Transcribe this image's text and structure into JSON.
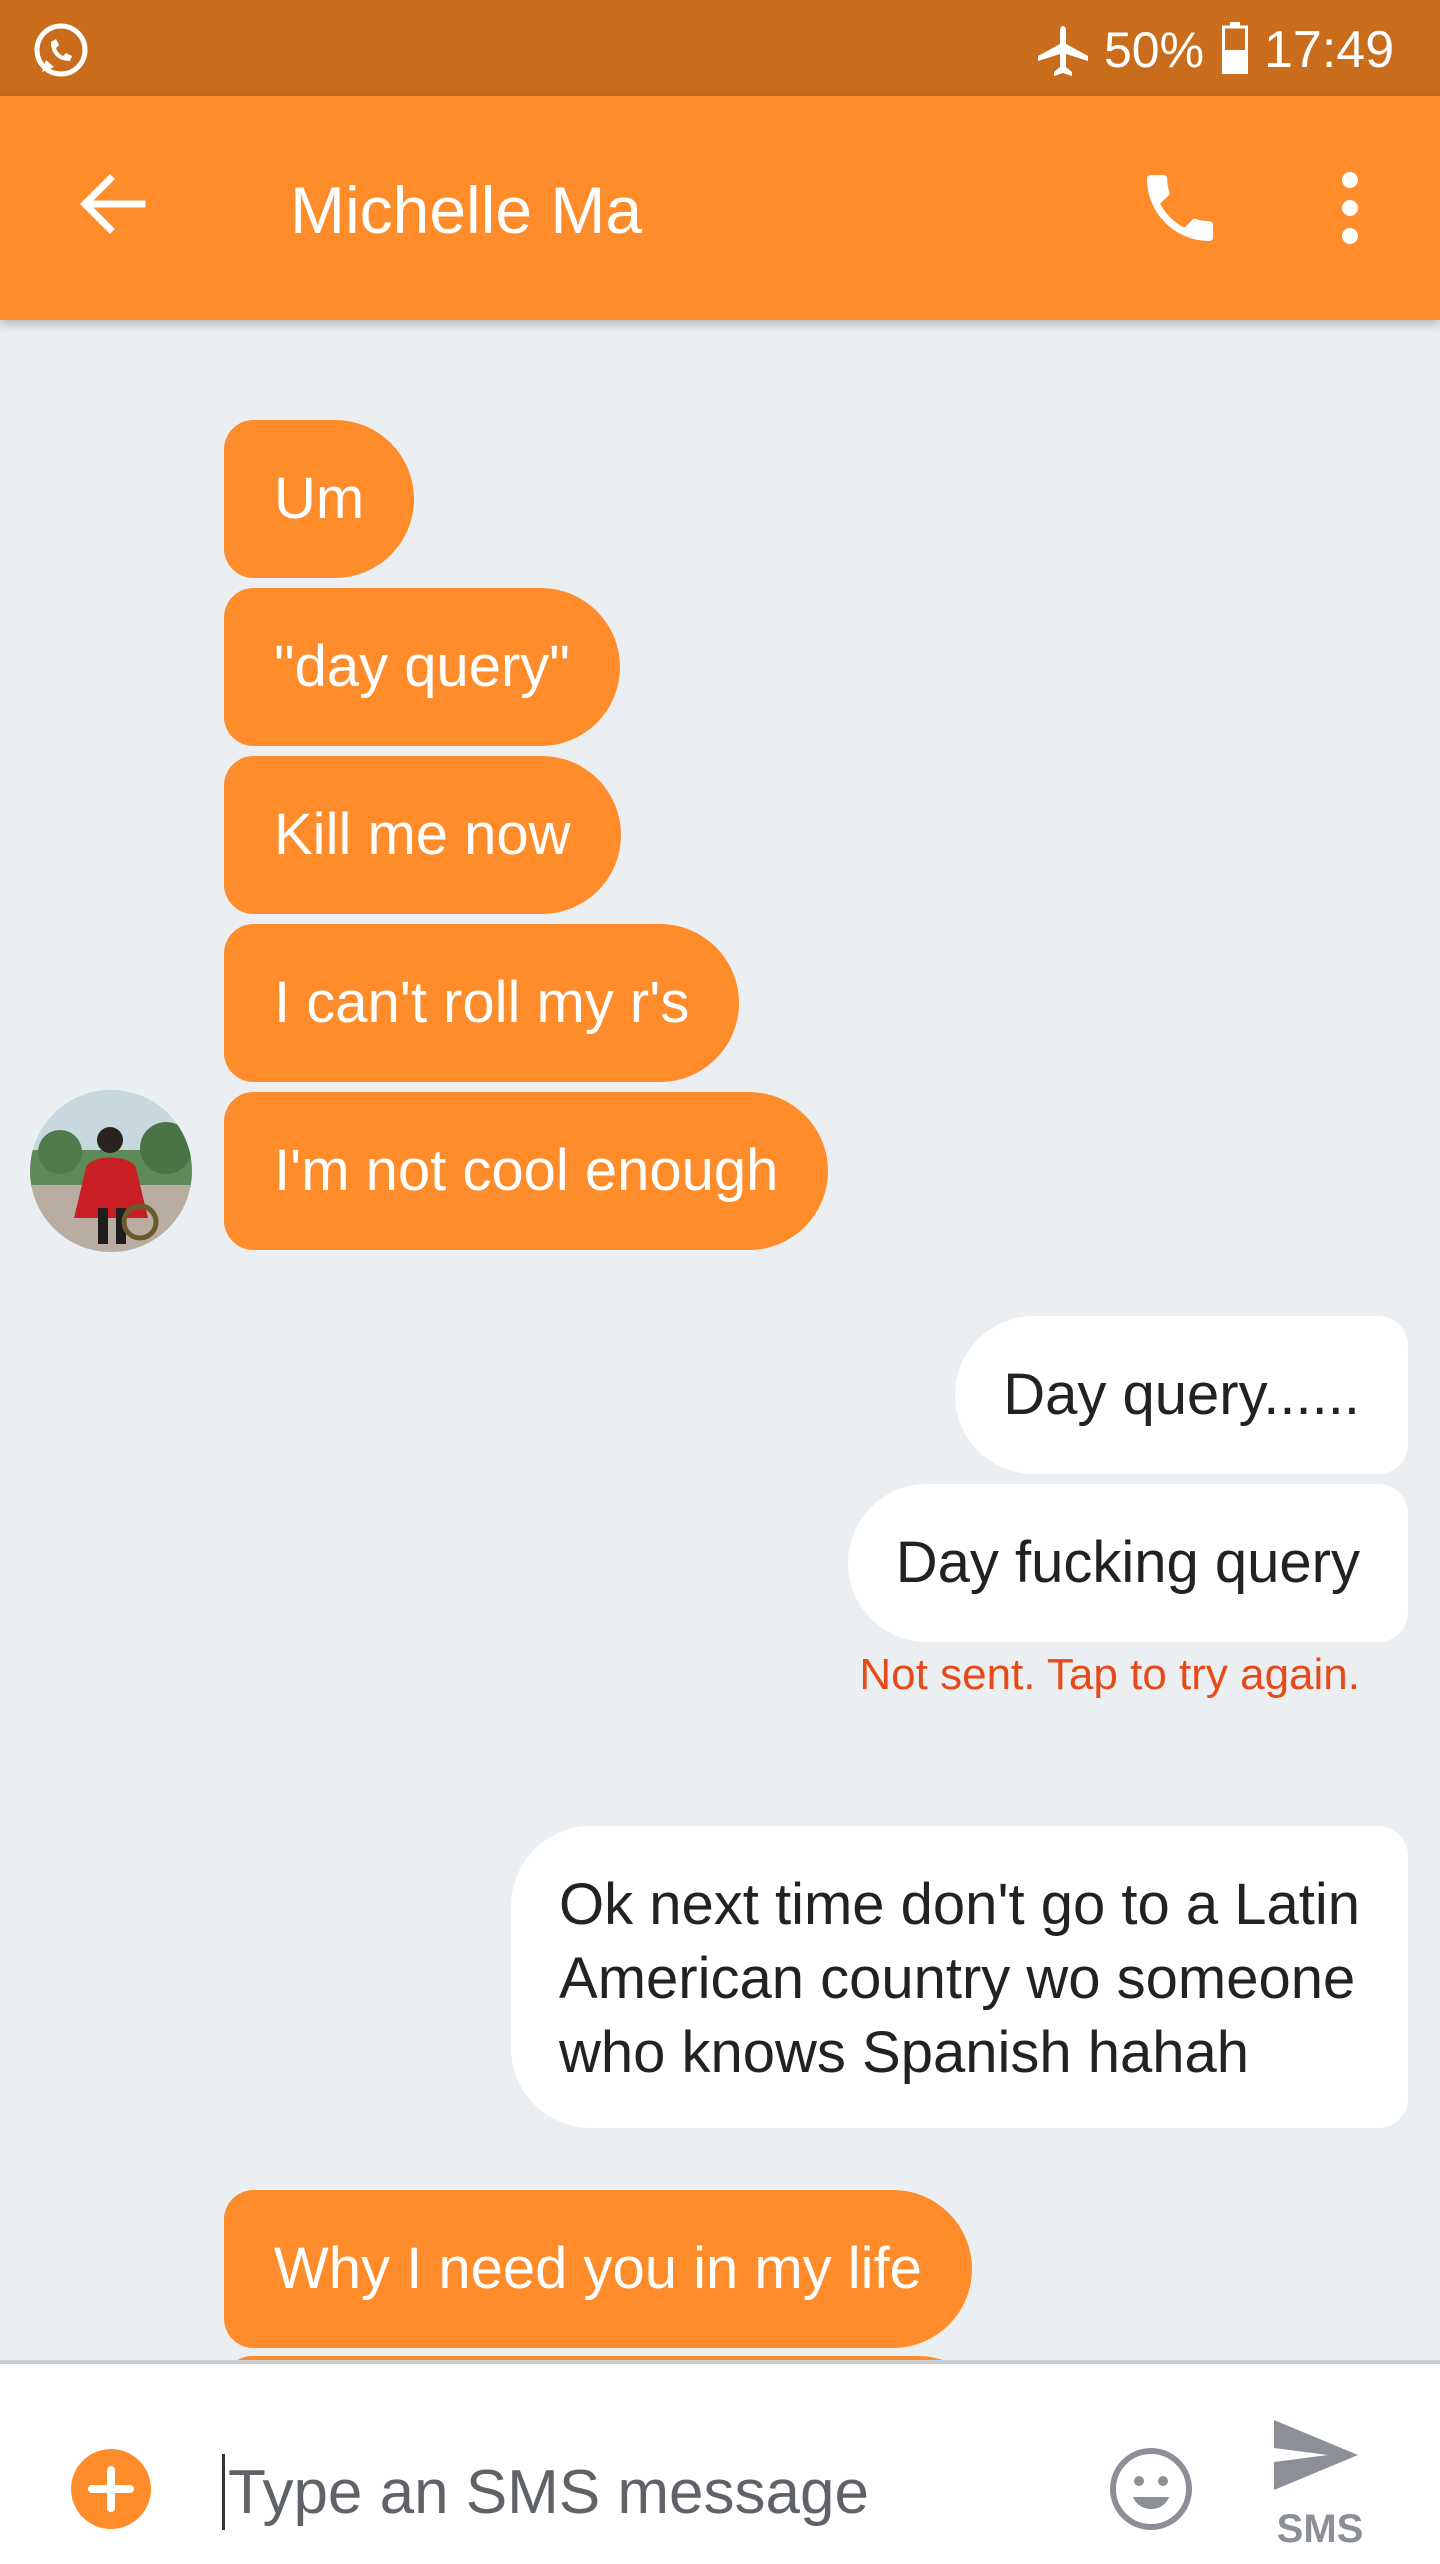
{
  "status_bar": {
    "app_icon": "whatsapp-icon",
    "airplane_icon": "airplane-icon",
    "battery_percent": "50%",
    "battery_level": 0.5,
    "time": "17:49"
  },
  "header": {
    "back_icon": "arrow-left-icon",
    "title": "Michelle Ma",
    "call_icon": "phone-icon",
    "menu_icon": "more-vert-icon"
  },
  "messages": [
    {
      "direction": "incoming",
      "text": "Um"
    },
    {
      "direction": "incoming",
      "text": "\"day query\""
    },
    {
      "direction": "incoming",
      "text": "Kill me now"
    },
    {
      "direction": "incoming",
      "text": "I can't roll my r's"
    },
    {
      "direction": "incoming",
      "text": "I'm not cool enough"
    },
    {
      "direction": "outgoing",
      "text": "Day query......"
    },
    {
      "direction": "outgoing",
      "text": "Day fucking query"
    },
    {
      "direction": "outgoing",
      "lines": [
        "Ok next time don't go to a Latin",
        "American country wo someone",
        "who knows Spanish hahah"
      ]
    },
    {
      "direction": "incoming",
      "text": "Why I need you in my life"
    }
  ],
  "send_error": "Not sent. Tap to try again.",
  "composer": {
    "placeholder": "Type an SMS message",
    "value": "",
    "send_label": "SMS",
    "add_icon": "add-circle-icon",
    "emoji_icon": "emoji-icon",
    "send_icon": "send-icon"
  },
  "colors": {
    "status_bar": "#C96C1C",
    "accent": "#FF8C2A",
    "background": "#ECEFF1",
    "outgoing_bubble": "#FFFFFF",
    "error": "#E64A19"
  }
}
